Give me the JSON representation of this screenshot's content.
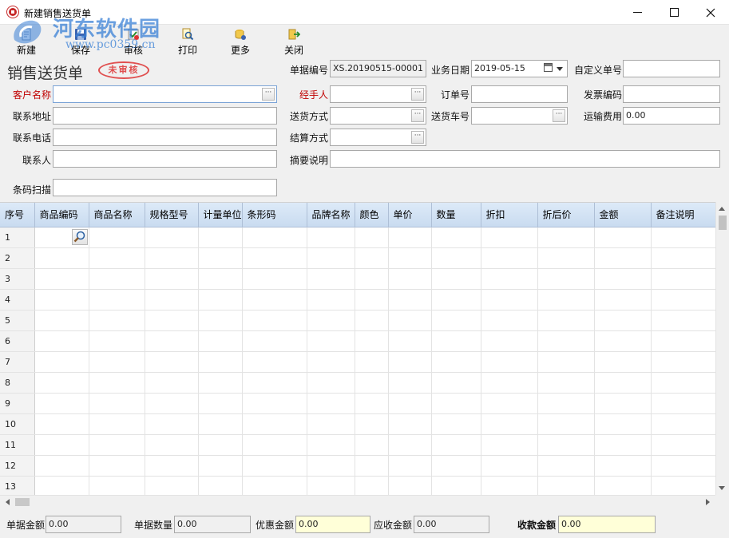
{
  "window": {
    "title": "新建销售送货单",
    "minimize_icon": "minimize-icon",
    "maximize_icon": "maximize-icon",
    "close_icon": "close-icon"
  },
  "watermark": {
    "line1": "河东软件园",
    "line2": "www.pc0359.cn"
  },
  "toolbar": {
    "new_label": "新建",
    "save_label": "保存",
    "audit_label": "审核",
    "print_label": "打印",
    "more_label": "更多",
    "close_label": "关闭"
  },
  "header": {
    "doc_title": "销售送货单",
    "stamp": "未审核",
    "doc_no_label": "单据编号",
    "doc_no_value": "XS.20190515-00001",
    "biz_date_label": "业务日期",
    "biz_date_value": "2019-05-15",
    "custom_no_label": "自定义单号",
    "custom_no_value": "",
    "customer_label": "客户名称",
    "customer_value": "",
    "handler_label": "经手人",
    "handler_value": "",
    "order_no_label": "订单号",
    "order_no_value": "",
    "invoice_label": "发票编码",
    "invoice_value": "",
    "address_label": "联系地址",
    "address_value": "",
    "delivery_method_label": "送货方式",
    "delivery_method_value": "",
    "vehicle_label": "送货车号",
    "vehicle_value": "",
    "freight_label": "运输费用",
    "freight_value": "0.00",
    "phone_label": "联系电话",
    "phone_value": "",
    "settlement_label": "结算方式",
    "settlement_value": "",
    "contact_label": "联系人",
    "contact_value": "",
    "summary_label": "摘要说明",
    "summary_value": "",
    "barcode_label": "条码扫描",
    "barcode_value": ""
  },
  "grid": {
    "columns": [
      "序号",
      "商品编码",
      "商品名称",
      "规格型号",
      "计量单位",
      "条形码",
      "品牌名称",
      "颜色",
      "单价",
      "数量",
      "折扣",
      "折后价",
      "金额",
      "备注说明"
    ],
    "row_numbers": [
      "1",
      "2",
      "3",
      "4",
      "5",
      "6",
      "7",
      "8",
      "9",
      "10",
      "11",
      "12",
      "13"
    ],
    "lookup_icon": "magnifier-icon"
  },
  "footer": {
    "doc_amount_label": "单据金额",
    "doc_amount_value": "0.00",
    "doc_qty_label": "单据数量",
    "doc_qty_value": "0.00",
    "discount_amount_label": "优惠金额",
    "discount_amount_value": "0.00",
    "receivable_label": "应收金额",
    "receivable_value": "0.00",
    "received_label": "收款金额",
    "received_value": "0.00"
  },
  "colors": {
    "required_label": "#c00000",
    "stamp": "#e05050",
    "grid_header": "#c9dbf0",
    "highlight_field": "#ffffd8"
  }
}
